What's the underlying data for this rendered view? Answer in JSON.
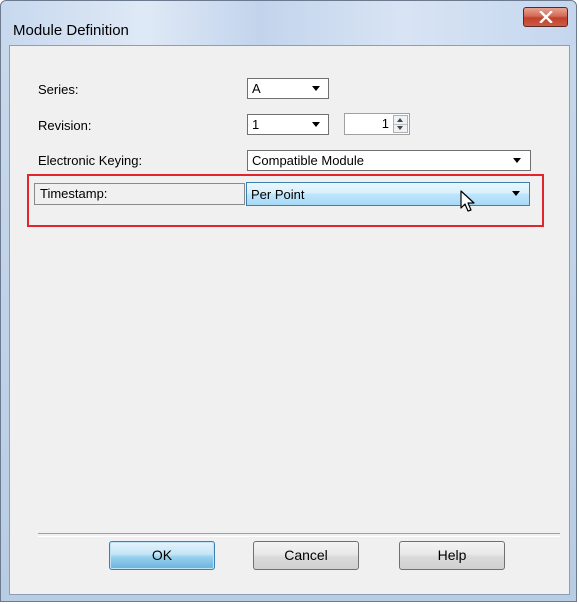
{
  "window": {
    "title": "Module Definition"
  },
  "fields": {
    "series": {
      "label": "Series:",
      "value": "A"
    },
    "revision": {
      "label": "Revision:",
      "major": "1",
      "minor": "1"
    },
    "keying": {
      "label": "Electronic Keying:",
      "value": "Compatible Module"
    },
    "timestamp": {
      "label": "Timestamp:",
      "value": "Per Point"
    }
  },
  "buttons": {
    "ok": "OK",
    "cancel": "Cancel",
    "help": "Help"
  },
  "colors": {
    "highlight": "#e0262c",
    "close_button": "#c0412b",
    "focus": "#3c7fb1"
  }
}
